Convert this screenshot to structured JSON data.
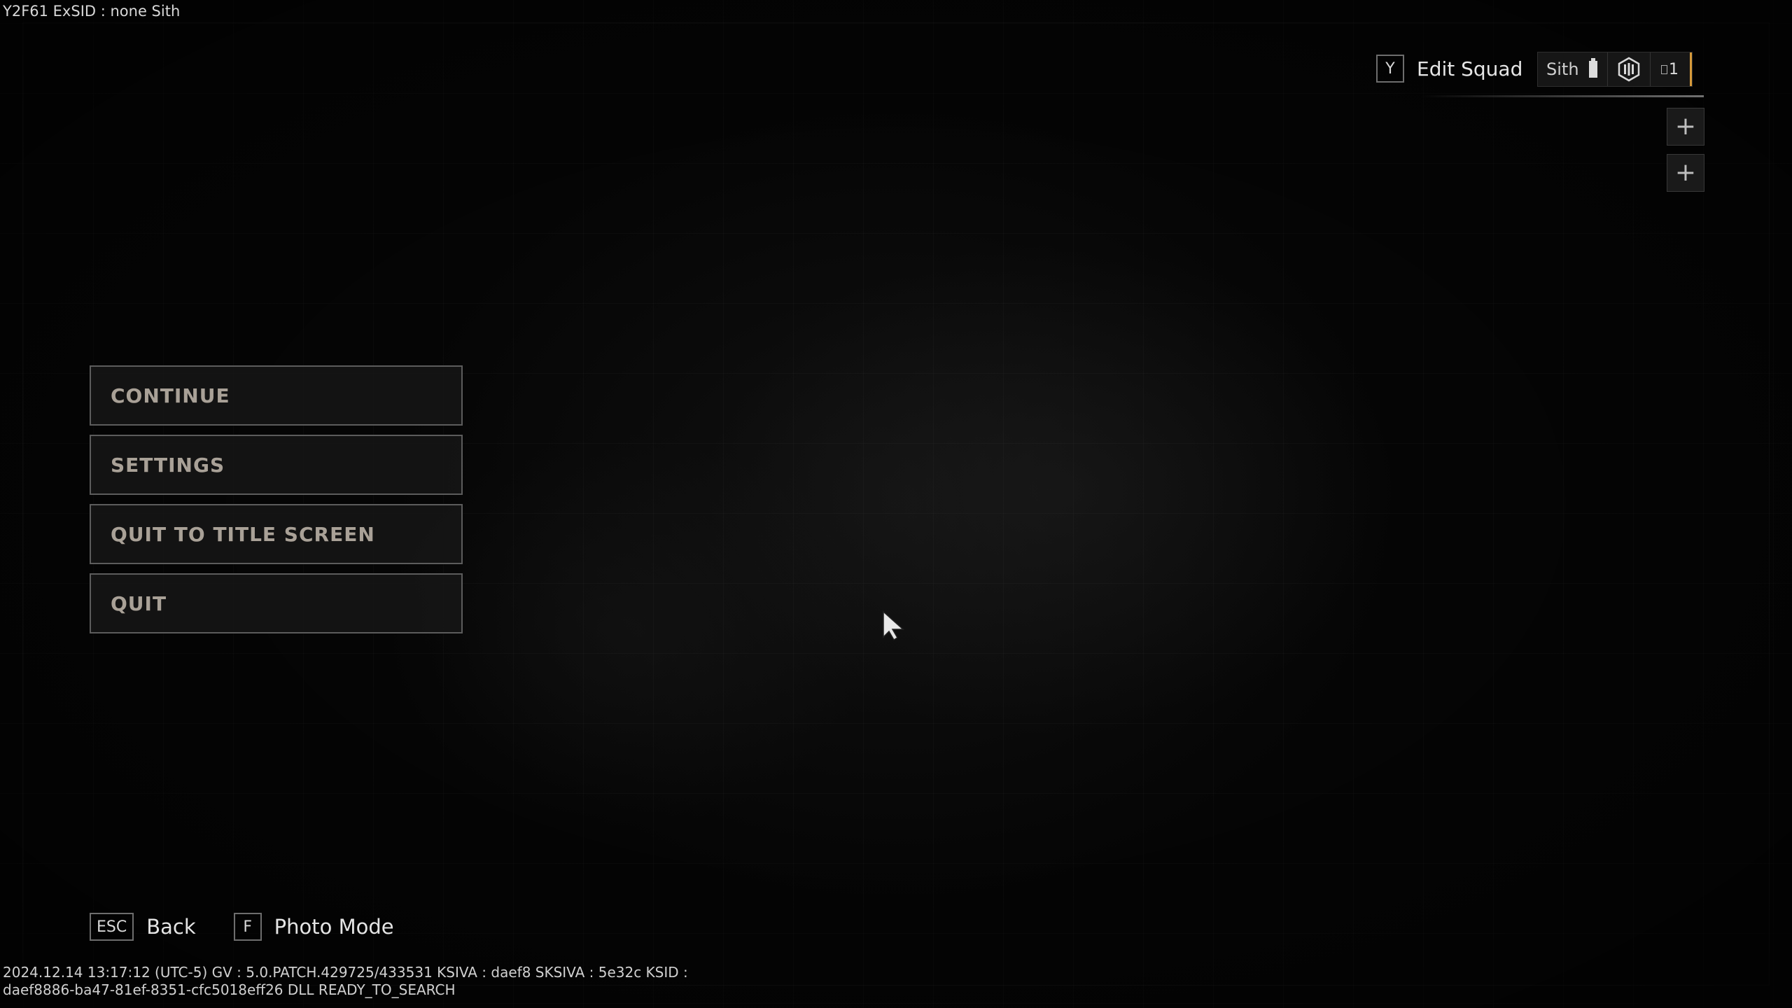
{
  "debug": {
    "top": "Y2F61  ExSID : none  Sith",
    "bottom_line1": "2024.12.14 13:17:12 (UTC-5)  GV : 5.0.PATCH.429725/433531  KSIVA : daef8  SKSIVA : 5e32c  KSID :",
    "bottom_line2": "daef8886-ba47-81ef-8351-cfc5018eff26  DLL  READY_TO_SEARCH"
  },
  "squad": {
    "key": "Y",
    "label": "Edit Squad",
    "member_name": "Sith",
    "level": "1"
  },
  "menu": {
    "items": [
      {
        "label": "CONTINUE"
      },
      {
        "label": "SETTINGS"
      },
      {
        "label": "QUIT TO TITLE SCREEN"
      },
      {
        "label": "QUIT"
      }
    ]
  },
  "prompts": {
    "back_key": "ESC",
    "back_label": "Back",
    "photo_key": "F",
    "photo_label": "Photo Mode"
  },
  "colors": {
    "accent": "#d79a3a",
    "menu_text": "#a9a197",
    "background": "#070707"
  }
}
